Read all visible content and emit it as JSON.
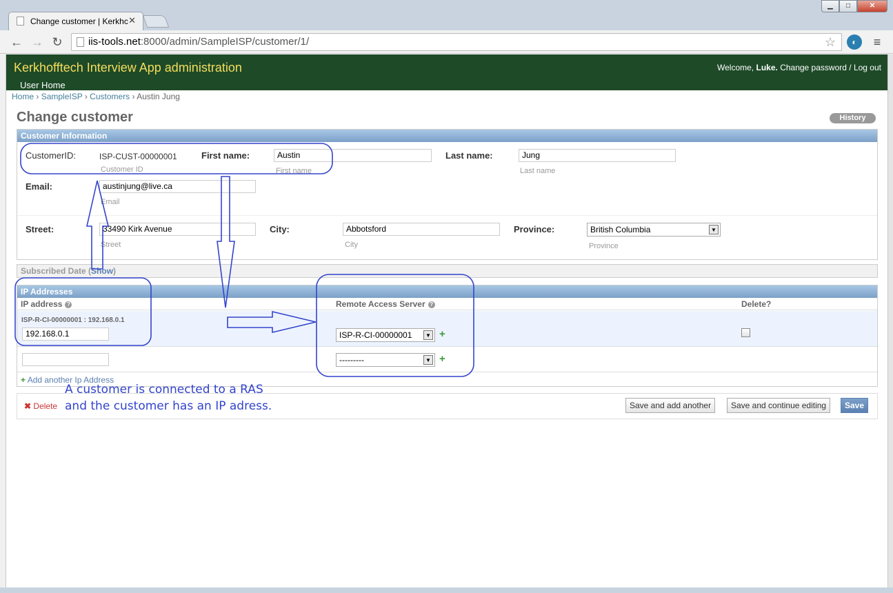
{
  "browser": {
    "tab_title": "Change customer | Kerkhc",
    "url_host": "iis-tools.net",
    "url_path": ":8000/admin/SampleISP/customer/1/"
  },
  "header": {
    "site_title": "Kerkhofftech Interview App administration",
    "welcome": "Welcome,",
    "username": "Luke.",
    "change_password": "Change password",
    "sep": "/",
    "logout": "Log out",
    "user_home": "User Home"
  },
  "breadcrumbs": [
    "Home",
    "SampleISP",
    "Customers",
    "Austin Jung"
  ],
  "page": {
    "title": "Change customer",
    "history": "History"
  },
  "customer_info": {
    "heading": "Customer Information",
    "customer_id_label": "CustomerID:",
    "customer_id_value": "ISP-CUST-00000001",
    "customer_id_help": "Customer ID",
    "first_name_label": "First name:",
    "first_name_value": "Austin",
    "first_name_help": "First name",
    "last_name_label": "Last name:",
    "last_name_value": "Jung",
    "last_name_help": "Last name",
    "email_label": "Email:",
    "email_value": "austinjung@live.ca",
    "email_help": "Email",
    "street_label": "Street:",
    "street_value": "33490 Kirk Avenue",
    "street_help": "Street",
    "city_label": "City:",
    "city_value": "Abbotsford",
    "city_help": "City",
    "province_label": "Province:",
    "province_value": "British Columbia",
    "province_help": "Province"
  },
  "subscribed": {
    "label": "Subscribed Date",
    "show": "Show"
  },
  "ip_addresses": {
    "heading": "IP Addresses",
    "col_ip": "IP address",
    "col_ras": "Remote Access Server",
    "col_delete": "Delete?",
    "row1_original": "ISP-R-CI-00000001 : 192.168.0.1",
    "row1_ip": "192.168.0.1",
    "row1_ras": "ISP-R-CI-00000001",
    "row2_ip": "",
    "row2_ras": "---------",
    "add_another": "Add another Ip Address"
  },
  "submit": {
    "delete": "Delete",
    "save_add": "Save and add another",
    "save_continue": "Save and continue editing",
    "save": "Save"
  },
  "annotation": {
    "line1": "A customer is connected to a RAS",
    "line2": "and the customer has an IP adress."
  },
  "colors": {
    "header_bg": "#1e4a28",
    "site_title": "#f5dd5d",
    "module_heading": "#7ca0c7",
    "annotation": "#3344cc"
  }
}
